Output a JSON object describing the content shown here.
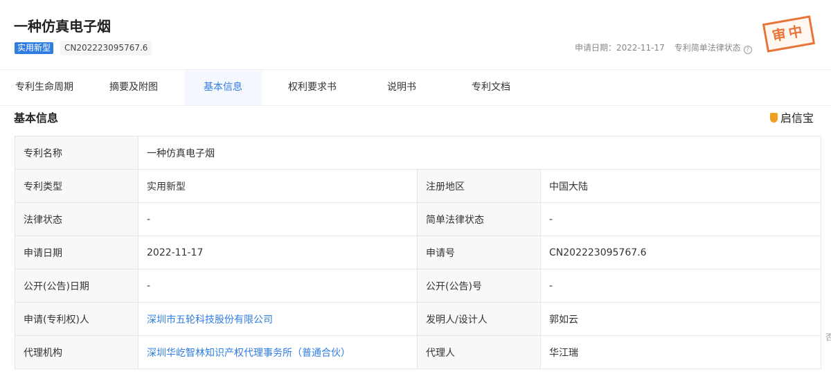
{
  "header": {
    "title": "一种仿真电子烟",
    "type_badge": "实用新型",
    "application_no": "CN202223095767.6",
    "date_text": "申请日期：2022-11-17",
    "status_text": "专利简单法律状态",
    "help_icon_glyph": "?",
    "stamp_text": "审中",
    "stamp_color": "#e8743a"
  },
  "tabs": [
    {
      "label": "专利生命周期"
    },
    {
      "label": "摘要及附图"
    },
    {
      "label": "基本信息",
      "active": true
    },
    {
      "label": "权利要求书"
    },
    {
      "label": "说明书"
    },
    {
      "label": "专利文档"
    }
  ],
  "section": {
    "title": "基本信息",
    "brand": "启信宝"
  },
  "edge_char": "否",
  "table": {
    "rows": [
      {
        "l1": "专利名称",
        "v1": "一种仿真电子烟"
      },
      {
        "l1": "专利类型",
        "v1": "实用新型",
        "l2": "注册地区",
        "v2": "中国大陆"
      },
      {
        "l1": "法律状态",
        "v1": "-",
        "l2": "简单法律状态",
        "v2": "-"
      },
      {
        "l1": "申请日期",
        "v1": "2022-11-17",
        "l2": "申请号",
        "v2": "CN202223095767.6"
      },
      {
        "l1": "公开(公告)日期",
        "v1": "-",
        "l2": "公开(公告)号",
        "v2": "-"
      },
      {
        "l1": "申请(专利权)人",
        "v1": "深圳市五轮科技股份有限公司",
        "l2": "发明人/设计人",
        "v2": "郭如云"
      },
      {
        "l1": "代理机构",
        "v1": "深圳华屹智林知识产权代理事务所（普通合伙）",
        "l2": "代理人",
        "v2": "华江瑞"
      }
    ]
  },
  "colors": {
    "accent": "#2f7de1",
    "label_bg": "#f7f8fa",
    "border": "#e6e6e6"
  }
}
